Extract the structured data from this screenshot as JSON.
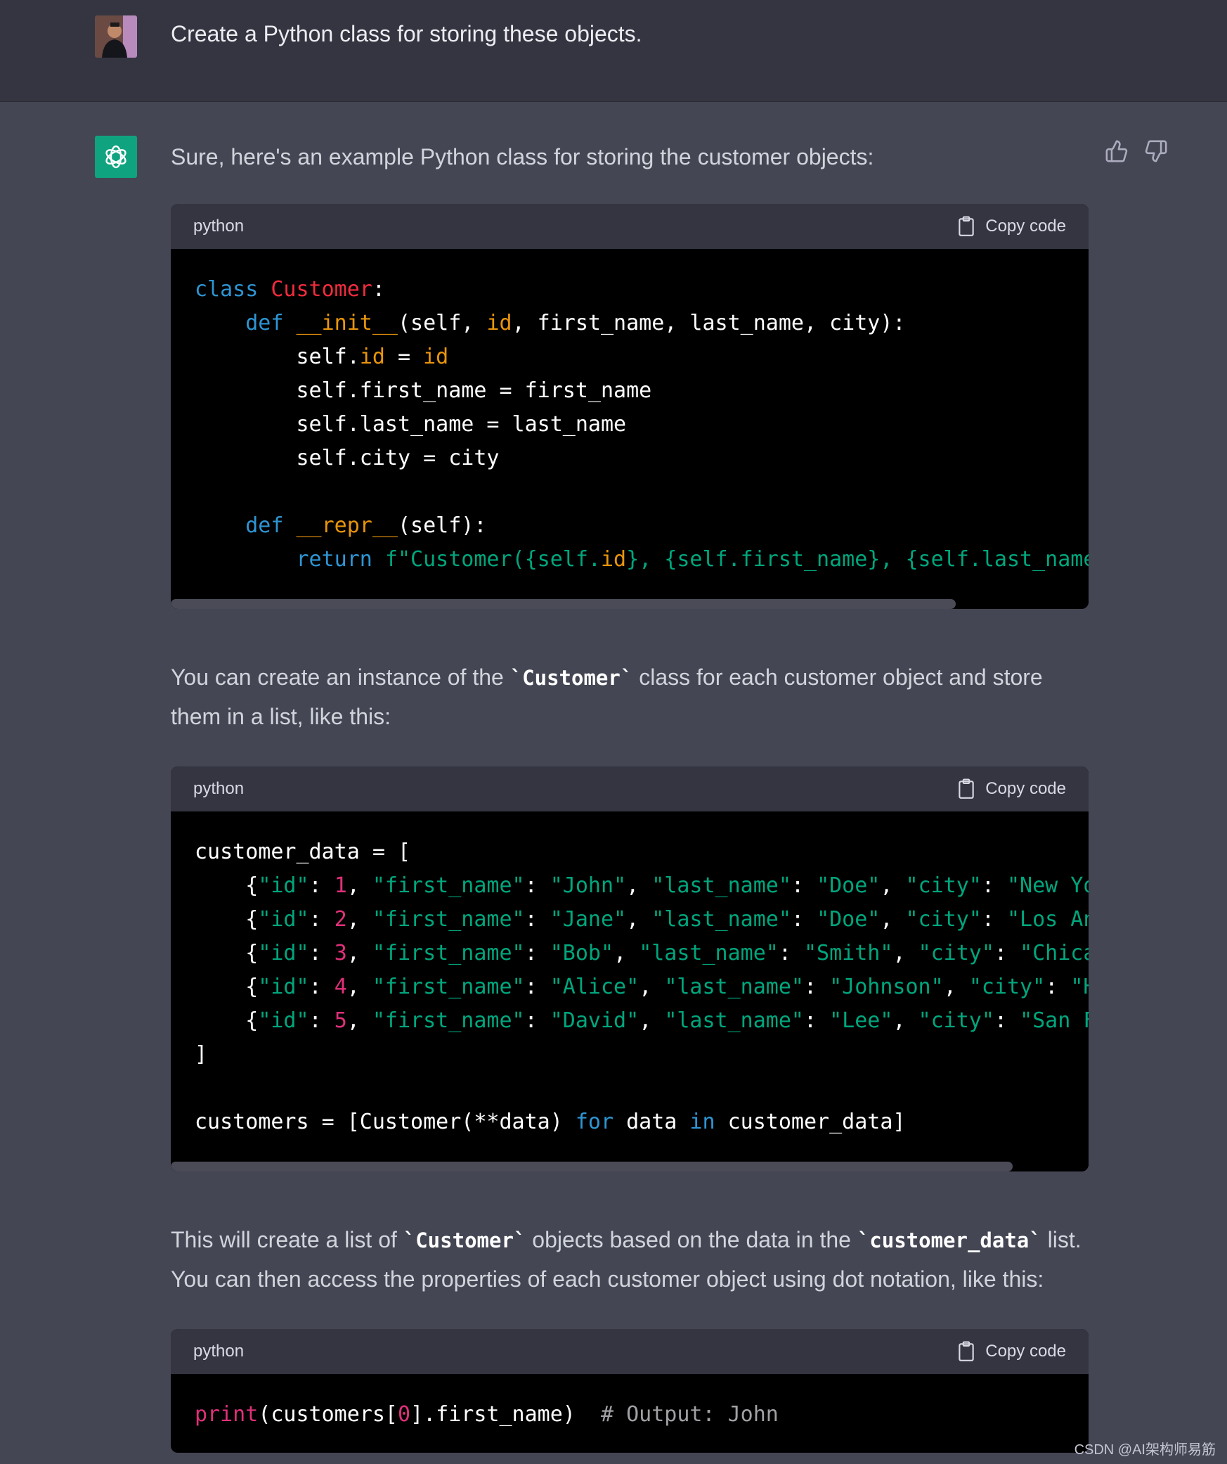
{
  "user_message": "Create a Python class for storing these objects.",
  "assistant": {
    "intro": "Sure, here's an example Python class for storing the customer objects:",
    "para2_before": "You can create an instance of the ",
    "para2_code": "`Customer`",
    "para2_after": " class for each customer object and store them in a list, like this:",
    "para3_before": "This will create a list of ",
    "para3_code1": "`Customer`",
    "para3_mid": " objects based on the data in the ",
    "para3_code2": "`customer_data`",
    "para3_after": " list. You can then access the properties of each customer object using dot notation, like this:"
  },
  "code_blocks": [
    {
      "language": "python",
      "copy_label": "Copy code",
      "scroll_fraction": 0.855,
      "lines": [
        [
          [
            "k",
            "class"
          ],
          [
            "t",
            " "
          ],
          [
            "c",
            "Customer"
          ],
          [
            "t",
            ":"
          ]
        ],
        [
          [
            "t",
            "    "
          ],
          [
            "k",
            "def"
          ],
          [
            "t",
            " "
          ],
          [
            "o",
            "__init__"
          ],
          [
            "t",
            "(self, "
          ],
          [
            "o",
            "id"
          ],
          [
            "t",
            ", first_name, last_name, city):"
          ]
        ],
        [
          [
            "t",
            "        self."
          ],
          [
            "o",
            "id"
          ],
          [
            "t",
            " = "
          ],
          [
            "o",
            "id"
          ]
        ],
        [
          [
            "t",
            "        self.first_name = first_name"
          ]
        ],
        [
          [
            "t",
            "        self.last_name = last_name"
          ]
        ],
        [
          [
            "t",
            "        self.city = city"
          ]
        ],
        [
          [
            "t",
            ""
          ]
        ],
        [
          [
            "t",
            "    "
          ],
          [
            "k",
            "def"
          ],
          [
            "t",
            " "
          ],
          [
            "o",
            "__repr__"
          ],
          [
            "t",
            "(self):"
          ]
        ],
        [
          [
            "t",
            "        "
          ],
          [
            "k",
            "return"
          ],
          [
            "t",
            " "
          ],
          [
            "s",
            "f\"Customer({self."
          ],
          [
            "o",
            "id"
          ],
          [
            "s",
            "}, {self.first_name}, {self.last_name}, {self.city})\""
          ]
        ]
      ]
    },
    {
      "language": "python",
      "copy_label": "Copy code",
      "scroll_fraction": 0.917,
      "lines": [
        [
          [
            "t",
            "customer_data = ["
          ]
        ],
        [
          [
            "t",
            "    {"
          ],
          [
            "s",
            "\"id\""
          ],
          [
            "t",
            ": "
          ],
          [
            "n",
            "1"
          ],
          [
            "t",
            ", "
          ],
          [
            "s",
            "\"first_name\""
          ],
          [
            "t",
            ": "
          ],
          [
            "s",
            "\"John\""
          ],
          [
            "t",
            ", "
          ],
          [
            "s",
            "\"last_name\""
          ],
          [
            "t",
            ": "
          ],
          [
            "s",
            "\"Doe\""
          ],
          [
            "t",
            ", "
          ],
          [
            "s",
            "\"city\""
          ],
          [
            "t",
            ": "
          ],
          [
            "s",
            "\"New York\""
          ],
          [
            "t",
            "},"
          ]
        ],
        [
          [
            "t",
            "    {"
          ],
          [
            "s",
            "\"id\""
          ],
          [
            "t",
            ": "
          ],
          [
            "n",
            "2"
          ],
          [
            "t",
            ", "
          ],
          [
            "s",
            "\"first_name\""
          ],
          [
            "t",
            ": "
          ],
          [
            "s",
            "\"Jane\""
          ],
          [
            "t",
            ", "
          ],
          [
            "s",
            "\"last_name\""
          ],
          [
            "t",
            ": "
          ],
          [
            "s",
            "\"Doe\""
          ],
          [
            "t",
            ", "
          ],
          [
            "s",
            "\"city\""
          ],
          [
            "t",
            ": "
          ],
          [
            "s",
            "\"Los Angeles\""
          ],
          [
            "t",
            "},"
          ]
        ],
        [
          [
            "t",
            "    {"
          ],
          [
            "s",
            "\"id\""
          ],
          [
            "t",
            ": "
          ],
          [
            "n",
            "3"
          ],
          [
            "t",
            ", "
          ],
          [
            "s",
            "\"first_name\""
          ],
          [
            "t",
            ": "
          ],
          [
            "s",
            "\"Bob\""
          ],
          [
            "t",
            ", "
          ],
          [
            "s",
            "\"last_name\""
          ],
          [
            "t",
            ": "
          ],
          [
            "s",
            "\"Smith\""
          ],
          [
            "t",
            ", "
          ],
          [
            "s",
            "\"city\""
          ],
          [
            "t",
            ": "
          ],
          [
            "s",
            "\"Chicago\""
          ],
          [
            "t",
            "},"
          ]
        ],
        [
          [
            "t",
            "    {"
          ],
          [
            "s",
            "\"id\""
          ],
          [
            "t",
            ": "
          ],
          [
            "n",
            "4"
          ],
          [
            "t",
            ", "
          ],
          [
            "s",
            "\"first_name\""
          ],
          [
            "t",
            ": "
          ],
          [
            "s",
            "\"Alice\""
          ],
          [
            "t",
            ", "
          ],
          [
            "s",
            "\"last_name\""
          ],
          [
            "t",
            ": "
          ],
          [
            "s",
            "\"Johnson\""
          ],
          [
            "t",
            ", "
          ],
          [
            "s",
            "\"city\""
          ],
          [
            "t",
            ": "
          ],
          [
            "s",
            "\"Houston\""
          ],
          [
            "t",
            "},"
          ]
        ],
        [
          [
            "t",
            "    {"
          ],
          [
            "s",
            "\"id\""
          ],
          [
            "t",
            ": "
          ],
          [
            "n",
            "5"
          ],
          [
            "t",
            ", "
          ],
          [
            "s",
            "\"first_name\""
          ],
          [
            "t",
            ": "
          ],
          [
            "s",
            "\"David\""
          ],
          [
            "t",
            ", "
          ],
          [
            "s",
            "\"last_name\""
          ],
          [
            "t",
            ": "
          ],
          [
            "s",
            "\"Lee\""
          ],
          [
            "t",
            ", "
          ],
          [
            "s",
            "\"city\""
          ],
          [
            "t",
            ": "
          ],
          [
            "s",
            "\"San Francisco\""
          ],
          [
            "t",
            "}"
          ]
        ],
        [
          [
            "t",
            "]"
          ]
        ],
        [
          [
            "t",
            ""
          ]
        ],
        [
          [
            "t",
            "customers = [Customer(**data) "
          ],
          [
            "k",
            "for"
          ],
          [
            "t",
            " data "
          ],
          [
            "k",
            "in"
          ],
          [
            "t",
            " customer_data]"
          ]
        ]
      ]
    },
    {
      "language": "python",
      "copy_label": "Copy code",
      "scroll_fraction": 1.0,
      "lines": [
        [
          [
            "f",
            "print"
          ],
          [
            "t",
            "(customers["
          ],
          [
            "n",
            "0"
          ],
          [
            "t",
            "].first_name)  "
          ],
          [
            "cm",
            "# Output: John"
          ]
        ]
      ]
    }
  ],
  "watermark": "CSDN @AI架构师易筋"
}
